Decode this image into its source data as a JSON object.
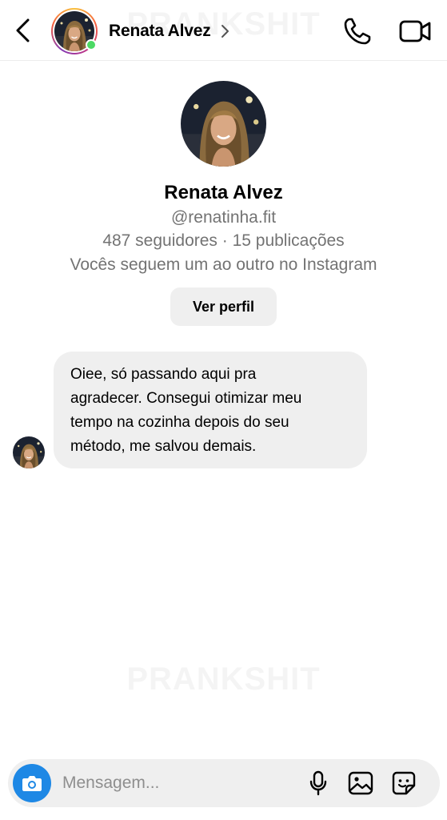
{
  "header": {
    "contact_name": "Renata Alvez",
    "icons": {
      "back": "chevron-left-icon",
      "forward": "chevron-right-icon",
      "call": "phone-icon",
      "video": "video-camera-icon"
    },
    "online": true
  },
  "watermark": "PRANKSHIT",
  "profile": {
    "name": "Renata Alvez",
    "handle": "@renatinha.fit",
    "stats": "487 seguidores · 15 publicações",
    "mutual": "Vocês seguem um ao outro no Instagram",
    "view_profile_label": "Ver perfil"
  },
  "messages": [
    {
      "sender": "Renata Alvez",
      "incoming": true,
      "lines": [
        "Oiee, só passando aqui pra",
        "agradecer. Consegui otimizar meu",
        "tempo na cozinha depois do seu",
        "método, me salvou demais."
      ]
    }
  ],
  "composer": {
    "placeholder": "Mensagem...",
    "icons": {
      "camera": "camera-icon",
      "mic": "microphone-icon",
      "gallery": "image-icon",
      "sticker": "sticker-icon"
    }
  },
  "colors": {
    "accent": "#1e88e5",
    "online": "#4cd964",
    "bubble": "#efefef",
    "secondary_text": "#737373"
  }
}
